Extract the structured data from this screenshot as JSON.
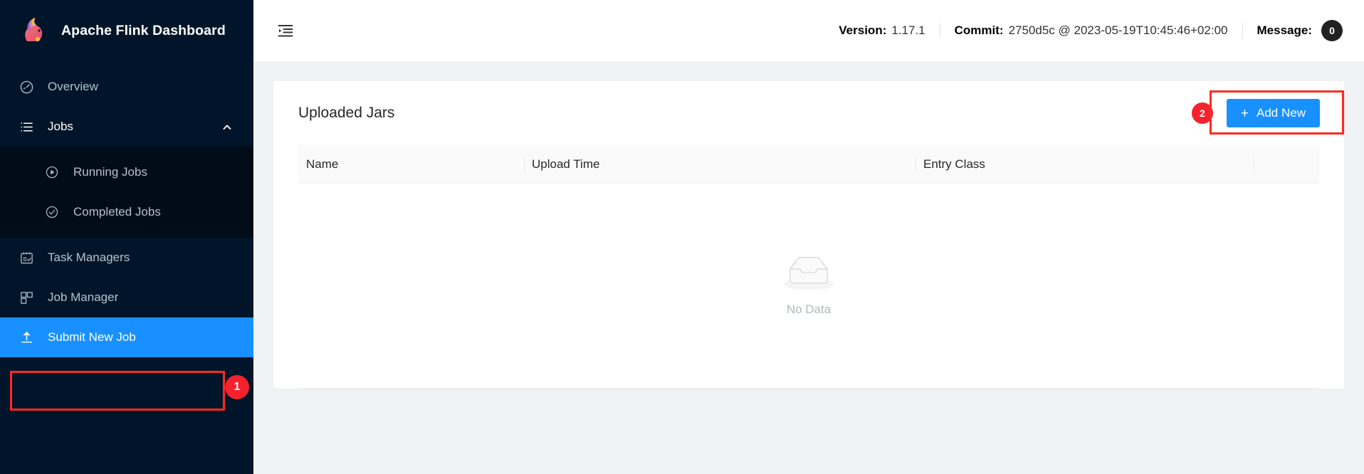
{
  "brand": {
    "title": "Apache Flink Dashboard",
    "logo_icon": "flink-squirrel-logo"
  },
  "sidebar": {
    "items": [
      {
        "label": "Overview",
        "icon": "dashboard-icon",
        "state": "normal"
      },
      {
        "label": "Jobs",
        "icon": "list-icon",
        "state": "open",
        "chevron": "chevron-up-icon"
      },
      {
        "label": "Running Jobs",
        "icon": "play-circle-icon",
        "state": "sub"
      },
      {
        "label": "Completed Jobs",
        "icon": "check-circle-icon",
        "state": "sub"
      },
      {
        "label": "Task Managers",
        "icon": "schedule-icon",
        "state": "normal"
      },
      {
        "label": "Job Manager",
        "icon": "blocks-icon",
        "state": "normal"
      },
      {
        "label": "Submit New Job",
        "icon": "upload-icon",
        "state": "active"
      }
    ],
    "active_badge": "1"
  },
  "topbar": {
    "fold_icon": "menu-fold-icon",
    "version_label": "Version:",
    "version_value": "1.17.1",
    "commit_label": "Commit:",
    "commit_value": "2750d5c @ 2023-05-19T10:45:46+02:00",
    "message_label": "Message:",
    "message_count": "0"
  },
  "card": {
    "title": "Uploaded Jars",
    "add_badge": "2",
    "add_button_label": "Add New",
    "add_button_icon": "plus-icon",
    "table": {
      "columns": [
        "Name",
        "Upload Time",
        "Entry Class",
        ""
      ],
      "rows": [],
      "empty_text": "No Data",
      "empty_icon": "empty-inbox-icon"
    }
  },
  "colors": {
    "accent_blue": "#1890ff",
    "annotation_red": "#ff2a22",
    "badge_red": "#f5222d",
    "sidebar_bg": "#001529",
    "submenu_bg": "#000c17",
    "page_bg": "#f0f2f5"
  }
}
